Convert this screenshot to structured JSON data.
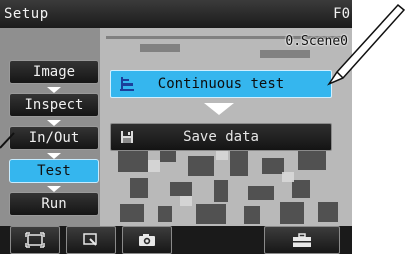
{
  "titlebar": {
    "title": "Setup",
    "code": "F0"
  },
  "scene": {
    "label": "0.Scene0"
  },
  "menu": [
    {
      "label": "Image",
      "active": false
    },
    {
      "label": "Inspect",
      "active": false
    },
    {
      "label": "In/Out",
      "active": false
    },
    {
      "label": "Test",
      "active": true
    },
    {
      "label": "Run",
      "active": false
    }
  ],
  "actions": {
    "continuous_test": "Continuous test",
    "save_data": "Save data"
  },
  "toolbar": {
    "icons": [
      "fit-frame-icon",
      "zoom-icon",
      "camera-icon",
      "tools-icon"
    ]
  },
  "colors": {
    "accent": "#35b6ee",
    "bar": "#1b1b1b"
  }
}
